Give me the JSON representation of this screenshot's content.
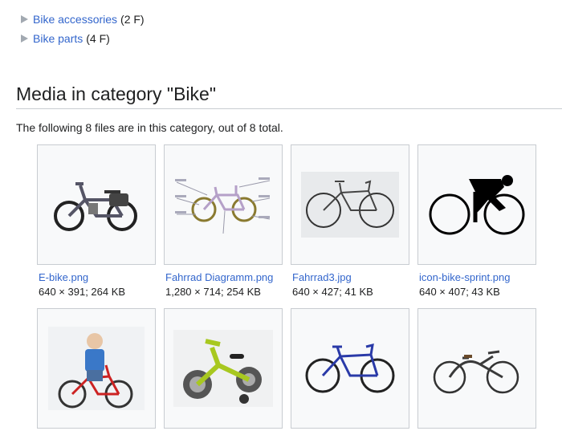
{
  "subcategories": [
    {
      "label": "Bike accessories",
      "count": "(2 F)"
    },
    {
      "label": "Bike parts",
      "count": "(4 F)"
    }
  ],
  "section": {
    "title": "Media in category \"Bike\"",
    "summary": "The following 8 files are in this category, out of 8 total."
  },
  "files": [
    {
      "name": "E-bike.png",
      "meta": "640 × 391; 264 KB",
      "icon": "e-bike-photo"
    },
    {
      "name": "Fahrrad Diagramm.png",
      "meta": "1,280 × 714; 254 KB",
      "icon": "bike-diagram"
    },
    {
      "name": "Fahrrad3.jpg",
      "meta": "640 × 427; 41 KB",
      "icon": "road-bike-photo"
    },
    {
      "name": "icon-bike-sprint.png",
      "meta": "640 × 407; 43 KB",
      "icon": "cyclist-sprint-icon"
    },
    {
      "name": "",
      "meta": "",
      "icon": "boy-on-bike-photo"
    },
    {
      "name": "",
      "meta": "",
      "icon": "kids-bike-photo"
    },
    {
      "name": "",
      "meta": "",
      "icon": "racing-bike-photo"
    },
    {
      "name": "",
      "meta": "",
      "icon": "vintage-bike-photo"
    }
  ],
  "colors": {
    "link": "#3366cc",
    "text": "#202122",
    "border": "#c8ccd1",
    "thumb_bg": "#f8f9fa"
  }
}
